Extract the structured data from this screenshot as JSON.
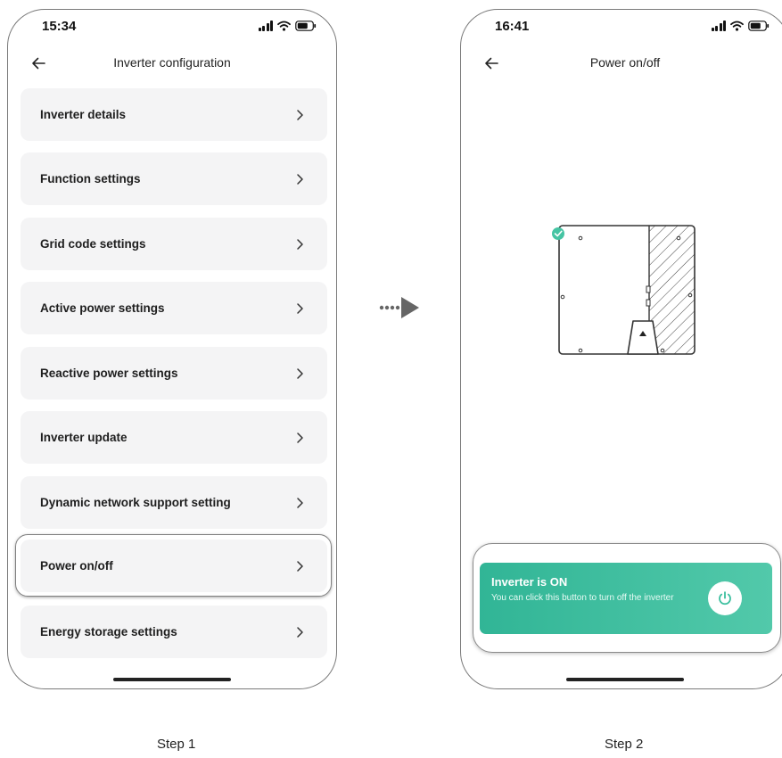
{
  "colors": {
    "accent_green": "#35b999",
    "menu_bg": "#f4f4f5",
    "frame_gray": "#7f7f7f"
  },
  "flow_arrow_icon": "dotted-right-arrow-icon",
  "screen1": {
    "status_time": "15:34",
    "title": "Inverter configuration",
    "menu_items": [
      {
        "label": "Inverter details"
      },
      {
        "label": "Function settings"
      },
      {
        "label": "Grid code settings"
      },
      {
        "label": "Active power settings"
      },
      {
        "label": "Reactive power settings"
      },
      {
        "label": "Inverter update"
      },
      {
        "label": "Dynamic network support setting"
      },
      {
        "label": "Power on/off",
        "highlighted": true
      },
      {
        "label": "Energy storage settings"
      }
    ],
    "step_label": "Step 1"
  },
  "screen2": {
    "status_time": "16:41",
    "title": "Power on/off",
    "status_card": {
      "title": "Inverter is ON",
      "description": "You can click this button to turn off the inverter",
      "button_icon": "power-icon"
    },
    "step_label": "Step 2"
  }
}
